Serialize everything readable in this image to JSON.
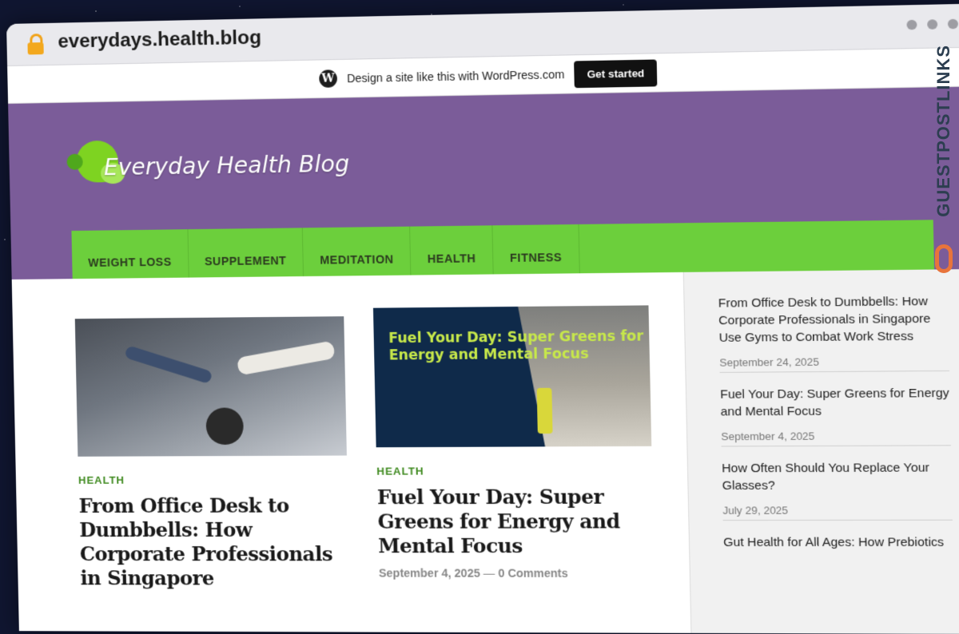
{
  "browser": {
    "url": "everydays.health.blog"
  },
  "wp_bar": {
    "text": "Design a site like this with WordPress.com",
    "button": "Get started"
  },
  "site": {
    "logo_text": "Everyday Health Blog"
  },
  "nav": {
    "items": [
      "WEIGHT LOSS",
      "SUPPLEMENT",
      "MEDITATION",
      "HEALTH",
      "FITNESS"
    ]
  },
  "posts": [
    {
      "category": "HEALTH",
      "title": "From Office Desk to Dumbbells: How Corporate Professionals in Singapore",
      "date": "",
      "comments": ""
    },
    {
      "category": "HEALTH",
      "title": "Fuel Your Day: Super Greens for Energy and Mental Focus",
      "image_text": "Fuel Your Day: Super Greens for Energy and Mental Focus",
      "date": "September 4, 2025",
      "comments": "0 Comments"
    }
  ],
  "sidebar": {
    "items": [
      {
        "title": "From Office Desk to Dumbbells: How Corporate Professionals in Singapore Use Gyms to Combat Work Stress",
        "date": "September 24, 2025"
      },
      {
        "title": "Fuel Your Day: Super Greens for Energy and Mental Focus",
        "date": "September 4, 2025"
      },
      {
        "title": "How Often Should You Replace Your Glasses?",
        "date": "July 29, 2025"
      },
      {
        "title": "Gut Health for All Ages: How Prebiotics",
        "date": ""
      }
    ]
  },
  "watermark": {
    "text": "GUESTPOSTLINKS"
  },
  "colors": {
    "header": "#7b5c99",
    "nav": "#6ccf3c",
    "category": "#3f8a1f"
  }
}
